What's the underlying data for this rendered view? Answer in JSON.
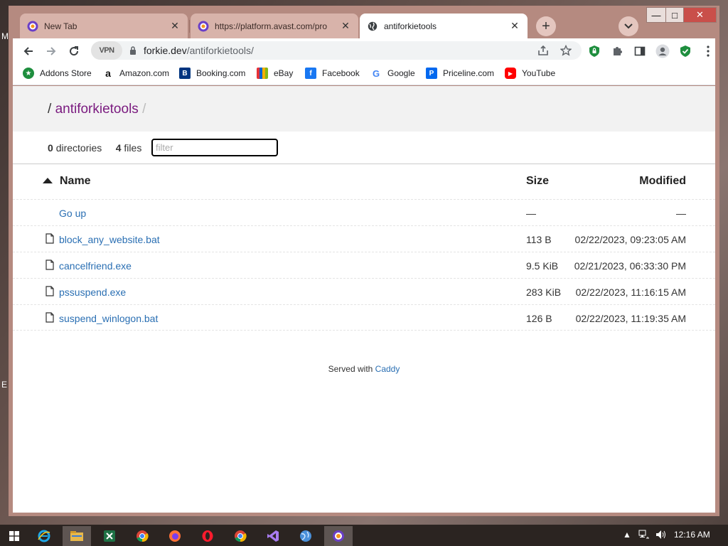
{
  "window": {
    "minimize_glyph": "—",
    "maximize_glyph": "□",
    "close_glyph": "✕"
  },
  "tabs": [
    {
      "title": "New Tab",
      "state": "inactive",
      "icon": "avast-secure-browser-icon",
      "close": "✕"
    },
    {
      "title": "https://platform.avast.com/pro",
      "state": "inactive",
      "icon": "avast-secure-browser-icon",
      "close": "✕"
    },
    {
      "title": "antiforkietools",
      "state": "active",
      "icon": "globe-icon",
      "close": "✕"
    }
  ],
  "new_tab_glyph": "+",
  "tab_search_glyph": "⌄",
  "toolbar": {
    "vpn_label": "VPN",
    "url_host": "forkie.dev",
    "url_path": "/antiforkietools/"
  },
  "bookmarks": [
    {
      "label": "Addons Store",
      "icon": "addons-store-icon",
      "color": "#1e8e3e"
    },
    {
      "label": "Amazon.com",
      "icon": "amazon-icon",
      "color": "#232f3e"
    },
    {
      "label": "Booking.com",
      "icon": "booking-icon",
      "color": "#003580"
    },
    {
      "label": "eBay",
      "icon": "ebay-icon",
      "color": "#e53238"
    },
    {
      "label": "Facebook",
      "icon": "facebook-icon",
      "color": "#1877f2"
    },
    {
      "label": "Google",
      "icon": "google-icon",
      "color": "#4285f4"
    },
    {
      "label": "Priceline.com",
      "icon": "priceline-icon",
      "color": "#0068ef"
    },
    {
      "label": "YouTube",
      "icon": "youtube-icon",
      "color": "#ff0000"
    }
  ],
  "page": {
    "breadcrumb_sep": "/",
    "breadcrumb_dir": "antiforkietools",
    "breadcrumb_tail": "/",
    "dir_count": "0",
    "dir_label": "directories",
    "file_count": "4",
    "file_label": "files",
    "filter_placeholder": "filter",
    "columns": {
      "name": "Name",
      "size": "Size",
      "modified": "Modified"
    },
    "sort_indicator": "ascending",
    "go_up": {
      "name": "Go up",
      "size": "—",
      "modified": "—"
    },
    "files": [
      {
        "name": "block_any_website.bat",
        "size": "113 B",
        "modified": "02/22/2023, 09:23:05 AM"
      },
      {
        "name": "cancelfriend.exe",
        "size": "9.5 KiB",
        "modified": "02/21/2023, 06:33:30 PM"
      },
      {
        "name": "pssuspend.exe",
        "size": "283 KiB",
        "modified": "02/22/2023, 11:16:15 AM"
      },
      {
        "name": "suspend_winlogon.bat",
        "size": "126 B",
        "modified": "02/22/2023, 11:19:35 AM"
      }
    ],
    "footer_text": "Served with",
    "footer_link": "Caddy"
  },
  "desktop_edge_letters": [
    "M",
    "E"
  ],
  "taskbar": {
    "apps": [
      "start-icon",
      "internet-explorer-icon",
      "file-explorer-icon",
      "excel-icon",
      "chrome-icon",
      "firefox-icon",
      "opera-icon",
      "chrome-icon",
      "visual-studio-icon",
      "network-globe-icon",
      "avast-secure-browser-icon"
    ],
    "active_app": "avast-secure-browser-icon",
    "time": "12:16 AM"
  },
  "colors": {
    "tabstrip": "#b58a80",
    "link": "#2a6fb3",
    "breadcrumb_link": "#7a1a7f",
    "avast_orange": "#f7941d",
    "avast_purple": "#6a3fc7"
  }
}
